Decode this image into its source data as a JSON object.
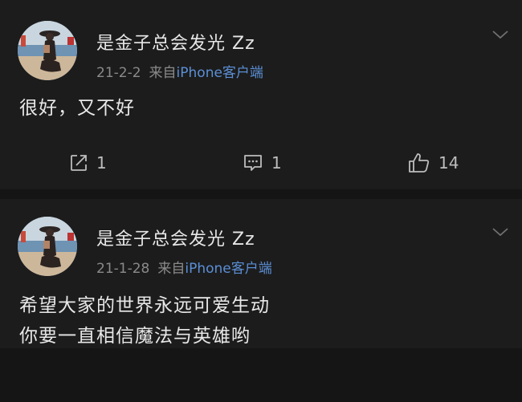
{
  "posts": [
    {
      "author": "是金子总会发光 Zz",
      "time": "21-2-2",
      "source_prefix": "来自",
      "source_client": "iPhone客户端",
      "content_lines": [
        "很好，又不好"
      ],
      "actions": {
        "repost_count": "1",
        "comment_count": "1",
        "like_count": "14"
      }
    },
    {
      "author": "是金子总会发光 Zz",
      "time": "21-1-28",
      "source_prefix": "来自",
      "source_client": "iPhone客户端",
      "content_lines": [
        "希望大家的世界永远可爱生动",
        "你要一直相信魔法与英雄哟"
      ]
    }
  ],
  "icons": {
    "avatar": "avatar-photo",
    "more": "chevron-down-icon",
    "repost": "repost-icon",
    "comment": "comment-icon",
    "like": "thumbs-up-icon"
  },
  "colors": {
    "background": "#151515",
    "card": "#1c1c1c",
    "text": "#e6e6e6",
    "meta": "#8a8a8a",
    "link": "#5b8fd6"
  }
}
